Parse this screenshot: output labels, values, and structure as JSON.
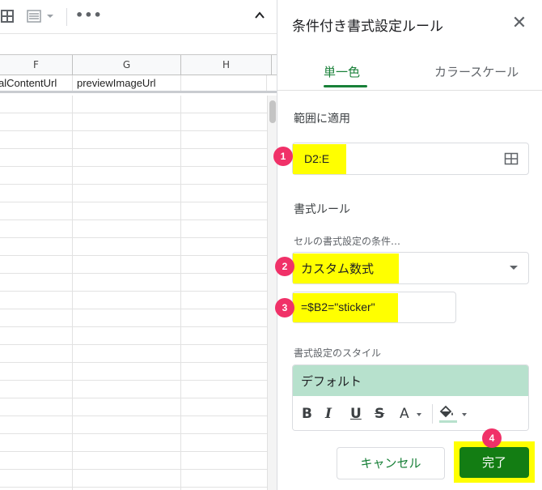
{
  "sheet": {
    "columns": [
      "F",
      "G",
      "H"
    ],
    "row1": [
      "alContentUrl",
      "previewImageUrl",
      ""
    ]
  },
  "toolbar": {
    "grid_icon": "grid-icon",
    "filter_icon": "filter-views-icon",
    "more_icon": "more-horizontal-icon",
    "collapse_icon": "chevron-up-icon"
  },
  "panel": {
    "title": "条件付き書式設定ルール",
    "close_icon": "close-icon",
    "tabs": [
      {
        "label": "単一色",
        "active": true
      },
      {
        "label": "カラースケール",
        "active": false
      }
    ],
    "apply_range_label": "範囲に適用",
    "apply_range_value": "D2:E",
    "rules_label": "書式ルール",
    "condition_label": "セルの書式設定の条件…",
    "condition_value": "カスタム数式",
    "formula_value": "=$B2=\"sticker\"",
    "style_label": "書式設定のスタイル",
    "style_preview": "デフォルト",
    "style_tools": [
      "B",
      "I",
      "U",
      "S",
      "A"
    ],
    "style_preview_color": "#b7e1cd",
    "cancel_label": "キャンセル",
    "done_label": "完了"
  },
  "annotations": {
    "badges": [
      "1",
      "2",
      "3",
      "4"
    ],
    "highlight_color": "#ffff00",
    "badge_color": "#f03168"
  },
  "colors": {
    "accent_green": "#188038",
    "done_button": "#137d13"
  }
}
